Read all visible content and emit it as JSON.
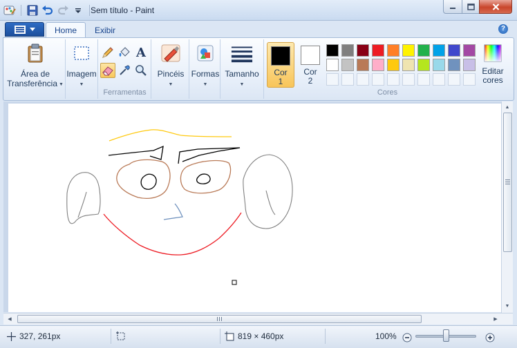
{
  "window": {
    "title": "Sem título - Paint",
    "minimize_label": "",
    "maximize_label": "",
    "close_label": ""
  },
  "tabs": [
    {
      "label": "Home",
      "active": true
    },
    {
      "label": "Exibir",
      "active": false
    }
  ],
  "ribbon": {
    "clipboard": {
      "label_line1": "Área de",
      "label_line2": "Transferência",
      "icon": "clipboard-icon"
    },
    "image": {
      "label": "Imagem",
      "icon": "select-rect-icon"
    },
    "tools": {
      "group_label": "Ferramentas",
      "items": [
        {
          "name": "pencil",
          "icon": "pencil-icon",
          "active": false
        },
        {
          "name": "fill",
          "icon": "fill-bucket-icon",
          "active": false
        },
        {
          "name": "text",
          "icon": "text-icon",
          "glyph": "A",
          "active": false
        },
        {
          "name": "eraser",
          "icon": "eraser-icon",
          "active": true
        },
        {
          "name": "color-picker",
          "icon": "color-picker-icon",
          "active": false
        },
        {
          "name": "magnifier",
          "icon": "magnifier-icon",
          "active": false
        }
      ]
    },
    "brushes": {
      "label": "Pincéis",
      "icon": "brush-icon"
    },
    "shapes": {
      "label": "Formas",
      "icon": "shapes-icon"
    },
    "size": {
      "label": "Tamanho",
      "icon": "line-size-icon"
    },
    "colors": {
      "group_label": "Cores",
      "color1": {
        "label_line1": "Cor",
        "label_line2": "1",
        "value": "#000000"
      },
      "color2": {
        "label_line1": "Cor",
        "label_line2": "2",
        "value": "#ffffff"
      },
      "edit_line1": "Editar",
      "edit_line2": "cores",
      "palette_row1": [
        "#000000",
        "#7f7f7f",
        "#880015",
        "#ed1c24",
        "#ff7f27",
        "#fff200",
        "#22b14c",
        "#00a2e8",
        "#3f48cc",
        "#a349a4"
      ],
      "palette_row2": [
        "#ffffff",
        "#c3c3c3",
        "#b97a57",
        "#ffaec9",
        "#ffc90e",
        "#efe4b0",
        "#b5e61d",
        "#99d9ea",
        "#7092be",
        "#c8bfe7"
      ],
      "palette_row3_empty": 10
    }
  },
  "status": {
    "cursor_position": "327, 261px",
    "selection_size": "",
    "canvas_size": "819 × 460px",
    "zoom": "100%",
    "zoom_level": 1.0
  }
}
